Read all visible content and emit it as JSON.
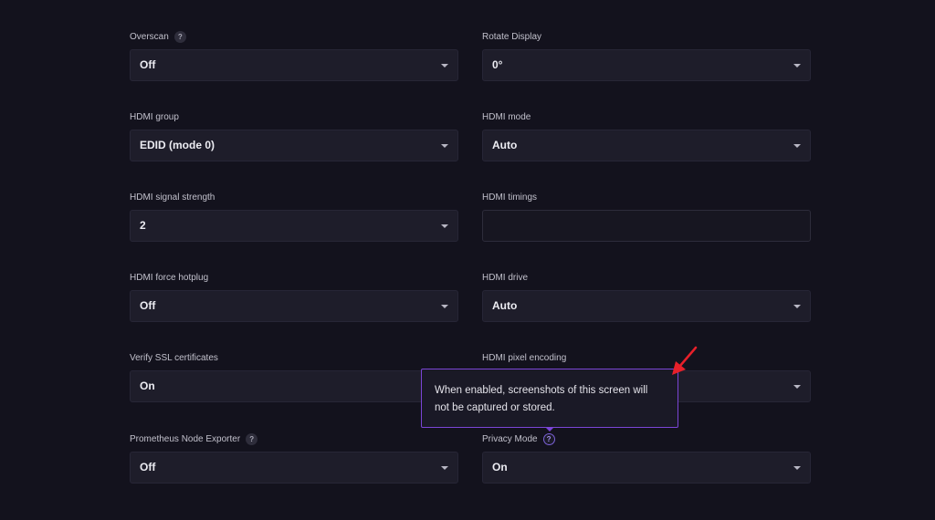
{
  "settings": {
    "overscan": {
      "label": "Overscan",
      "value": "Off"
    },
    "rotate_display": {
      "label": "Rotate Display",
      "value": "0°"
    },
    "hdmi_group": {
      "label": "HDMI group",
      "value": "EDID (mode 0)"
    },
    "hdmi_mode": {
      "label": "HDMI mode",
      "value": "Auto"
    },
    "hdmi_signal_strength": {
      "label": "HDMI signal strength",
      "value": "2"
    },
    "hdmi_timings": {
      "label": "HDMI timings",
      "value": ""
    },
    "hdmi_force_hotplug": {
      "label": "HDMI force hotplug",
      "value": "Off"
    },
    "hdmi_drive": {
      "label": "HDMI drive",
      "value": "Auto"
    },
    "verify_ssl": {
      "label": "Verify SSL certificates",
      "value": "On"
    },
    "hdmi_pixel_encoding": {
      "label": "HDMI pixel encoding",
      "value": ""
    },
    "prometheus_node_exporter": {
      "label": "Prometheus Node Exporter",
      "value": "Off"
    },
    "privacy_mode": {
      "label": "Privacy Mode",
      "value": "On"
    }
  },
  "help_icon_glyph": "?",
  "tooltip": {
    "text": "When enabled, screenshots of this screen will not be captured or stored."
  },
  "colors": {
    "background": "#13121d",
    "field_bg": "#1e1d2a",
    "tooltip_border": "#7b45d6",
    "annotation_arrow": "#e8202a"
  },
  "icons": {
    "help": "question-circle-icon",
    "dropdown": "caret-down-icon",
    "annotation": "red-arrow-icon"
  }
}
